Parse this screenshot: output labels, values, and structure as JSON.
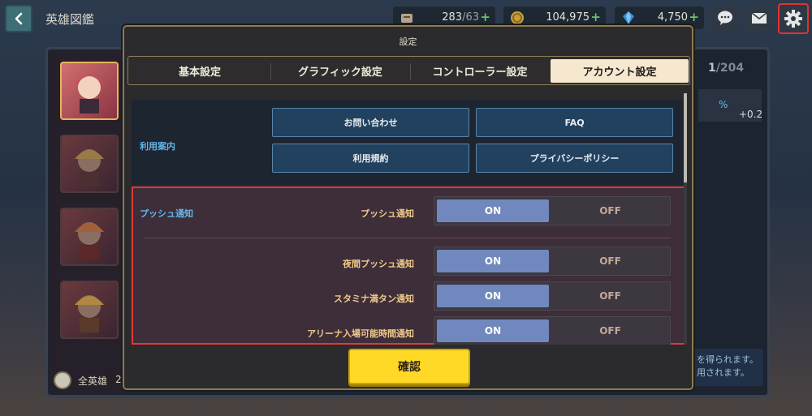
{
  "header": {
    "title": "英雄図鑑",
    "stamina": {
      "current": "283",
      "max": "63",
      "icon": "stamina-icon"
    },
    "gold": {
      "value": "104,975",
      "icon": "gold-coin-icon"
    },
    "gems": {
      "value": "4,750",
      "icon": "gem-icon"
    }
  },
  "background": {
    "count_current": "1",
    "count_total": "204",
    "stat": "+0.2",
    "stat_unit": "%",
    "note_line1": "を得られます。",
    "note_line2": "用されます。",
    "footer_label": "全英雄",
    "footer_extra": "2"
  },
  "modal": {
    "title": "設定",
    "tabs": [
      {
        "label": "基本設定",
        "active": false
      },
      {
        "label": "グラフィック設定",
        "active": false
      },
      {
        "label": "コントローラー設定",
        "active": false
      },
      {
        "label": "アカウント設定",
        "active": true
      }
    ],
    "info_section": {
      "label": "利用案内",
      "buttons": [
        "お問い合わせ",
        "FAQ",
        "利用規約",
        "プライバシーポリシー"
      ]
    },
    "push_section": {
      "label": "プッシュ通知",
      "rows": [
        {
          "label": "プッシュ通知",
          "on": "ON",
          "off": "OFF",
          "state": "ON"
        },
        {
          "label": "夜間プッシュ通知",
          "on": "ON",
          "off": "OFF",
          "state": "ON"
        },
        {
          "label": "スタミナ満タン通知",
          "on": "ON",
          "off": "OFF",
          "state": "ON"
        },
        {
          "label": "アリーナ入場可能時間通知",
          "on": "ON",
          "off": "OFF",
          "state": "ON"
        }
      ]
    },
    "confirm_label": "確認"
  },
  "colors": {
    "accent_confirm": "#ffd926",
    "toggle_on": "#7088be",
    "section_label": "#64b6ea",
    "row_label": "#f0c989",
    "highlight_border": "#e03a3a"
  }
}
